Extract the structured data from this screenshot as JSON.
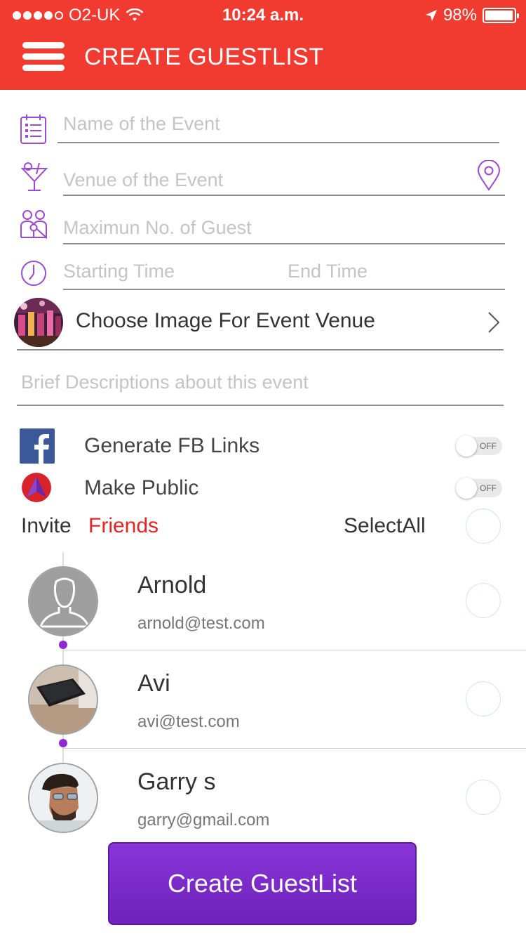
{
  "status_bar": {
    "carrier": "O2-UK",
    "time": "10:24 a.m.",
    "battery": "98%",
    "battery_level": 0.98
  },
  "header": {
    "title": "CREATE GUESTLIST"
  },
  "form": {
    "event_name_placeholder": "Name of the Event",
    "venue_placeholder": "Venue of the Event",
    "max_guest_placeholder": "Maximun No. of Guest",
    "start_time_placeholder": "Starting Time",
    "end_time_placeholder": "End Time",
    "choose_image_label": "Choose Image For Event Venue",
    "description_placeholder": "Brief Descriptions about this event"
  },
  "toggles": [
    {
      "label": "Generate FB Links",
      "state": "OFF"
    },
    {
      "label": "Make Public",
      "state": "OFF"
    }
  ],
  "invite": {
    "invite_label": "Invite",
    "friends_label": "Friends",
    "select_all_label": "SelectAll"
  },
  "friends": [
    {
      "name": "Arnold",
      "email": "arnold@test.com"
    },
    {
      "name": "Avi",
      "email": "avi@test.com"
    },
    {
      "name": "Garry s",
      "email": "garry@gmail.com"
    }
  ],
  "actions": {
    "create_label": "Create GuestList"
  },
  "colors": {
    "header": "#f23b30",
    "accent_purple": "#8e2bd1",
    "friends_red": "#e22424"
  }
}
